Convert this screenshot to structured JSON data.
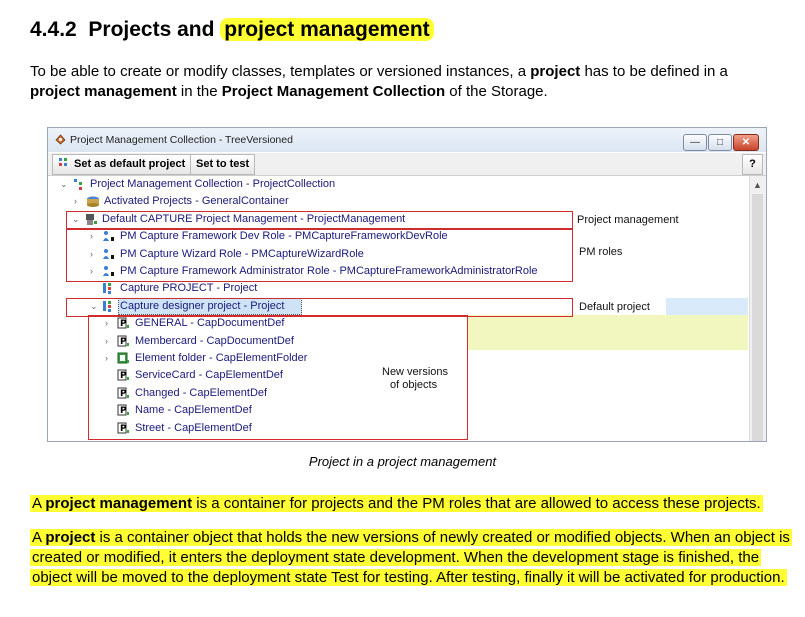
{
  "heading": {
    "number": "4.4.2",
    "plain": "Projects and",
    "highlighted": "project management"
  },
  "intro": {
    "t1": "To be able to create or modify classes, templates or versioned instances, a ",
    "b1": "project",
    "t2": " has to be defined in a ",
    "b2": "project management",
    "t3": " in the ",
    "b3": "Project Management Collection",
    "t4": " of the Storage."
  },
  "window": {
    "title": "Project Management Collection - TreeVersioned",
    "controls": {
      "minimize": "—",
      "maximize": "□",
      "close": "✕",
      "help": "?"
    },
    "toolbar": {
      "default_btn": "Set as default project",
      "test_btn": "Set to test"
    },
    "tree": [
      {
        "label": "Project Management Collection - ProjectCollection",
        "arrow": "⌄",
        "icon": "collection-icon"
      },
      {
        "label": "Activated Projects - GeneralContainer",
        "arrow": "›",
        "icon": "container-icon"
      },
      {
        "label": "Default CAPTURE Project Management - ProjectManagement",
        "arrow": "⌄",
        "icon": "project-management-icon"
      },
      {
        "label": "PM Capture Framework Dev Role - PMCaptureFrameworkDevRole",
        "arrow": "›",
        "icon": "role-icon"
      },
      {
        "label": "PM Capture Wizard Role - PMCaptureWizardRole",
        "arrow": "›",
        "icon": "role-icon"
      },
      {
        "label": "PM Capture Framework Administrator Role - PMCaptureFrameworkAdministratorRole",
        "arrow": "›",
        "icon": "role-icon"
      },
      {
        "label": "Capture PROJECT - Project",
        "arrow": "",
        "icon": "project-icon"
      },
      {
        "label": "Capture designer project - Project",
        "arrow": "⌄",
        "icon": "project-icon"
      },
      {
        "label": "GENERAL - CapDocumentDef",
        "arrow": "›",
        "icon": "document-def-icon"
      },
      {
        "label": "Membercard - CapDocumentDef",
        "arrow": "›",
        "icon": "document-def-icon"
      },
      {
        "label": "Element folder - CapElementFolder",
        "arrow": "›",
        "icon": "element-folder-icon"
      },
      {
        "label": "ServiceCard - CapElementDef",
        "arrow": "",
        "icon": "element-def-icon"
      },
      {
        "label": "Changed - CapElementDef",
        "arrow": "",
        "icon": "element-def-icon"
      },
      {
        "label": "Name - CapElementDef",
        "arrow": "",
        "icon": "element-def-icon"
      },
      {
        "label": "Street - CapElementDef",
        "arrow": "",
        "icon": "element-def-icon"
      }
    ],
    "annotations": {
      "project_management": "Project management",
      "pm_roles": "PM roles",
      "default_project": "Default project",
      "new_versions_1": "New versions",
      "new_versions_2": "of objects"
    }
  },
  "caption": "Project in a project management",
  "para1": {
    "t1": "A ",
    "b1": "project management",
    "t2": " is a container for projects and the PM roles that are allowed to access these projects."
  },
  "para2": {
    "t1": "A ",
    "b1": "project",
    "t2": " is a container object that holds the new versions of newly created or modified objects. When an object is created or modified, it enters the deployment state development. When the development stage is finished, the object will be moved to the deployment state Test for testing. After testing, finally it will be activated for production."
  },
  "colors": {
    "highlight": "#ffff33",
    "annotation_box": "#d22b2b",
    "tree_text": "#1a1a7a"
  }
}
